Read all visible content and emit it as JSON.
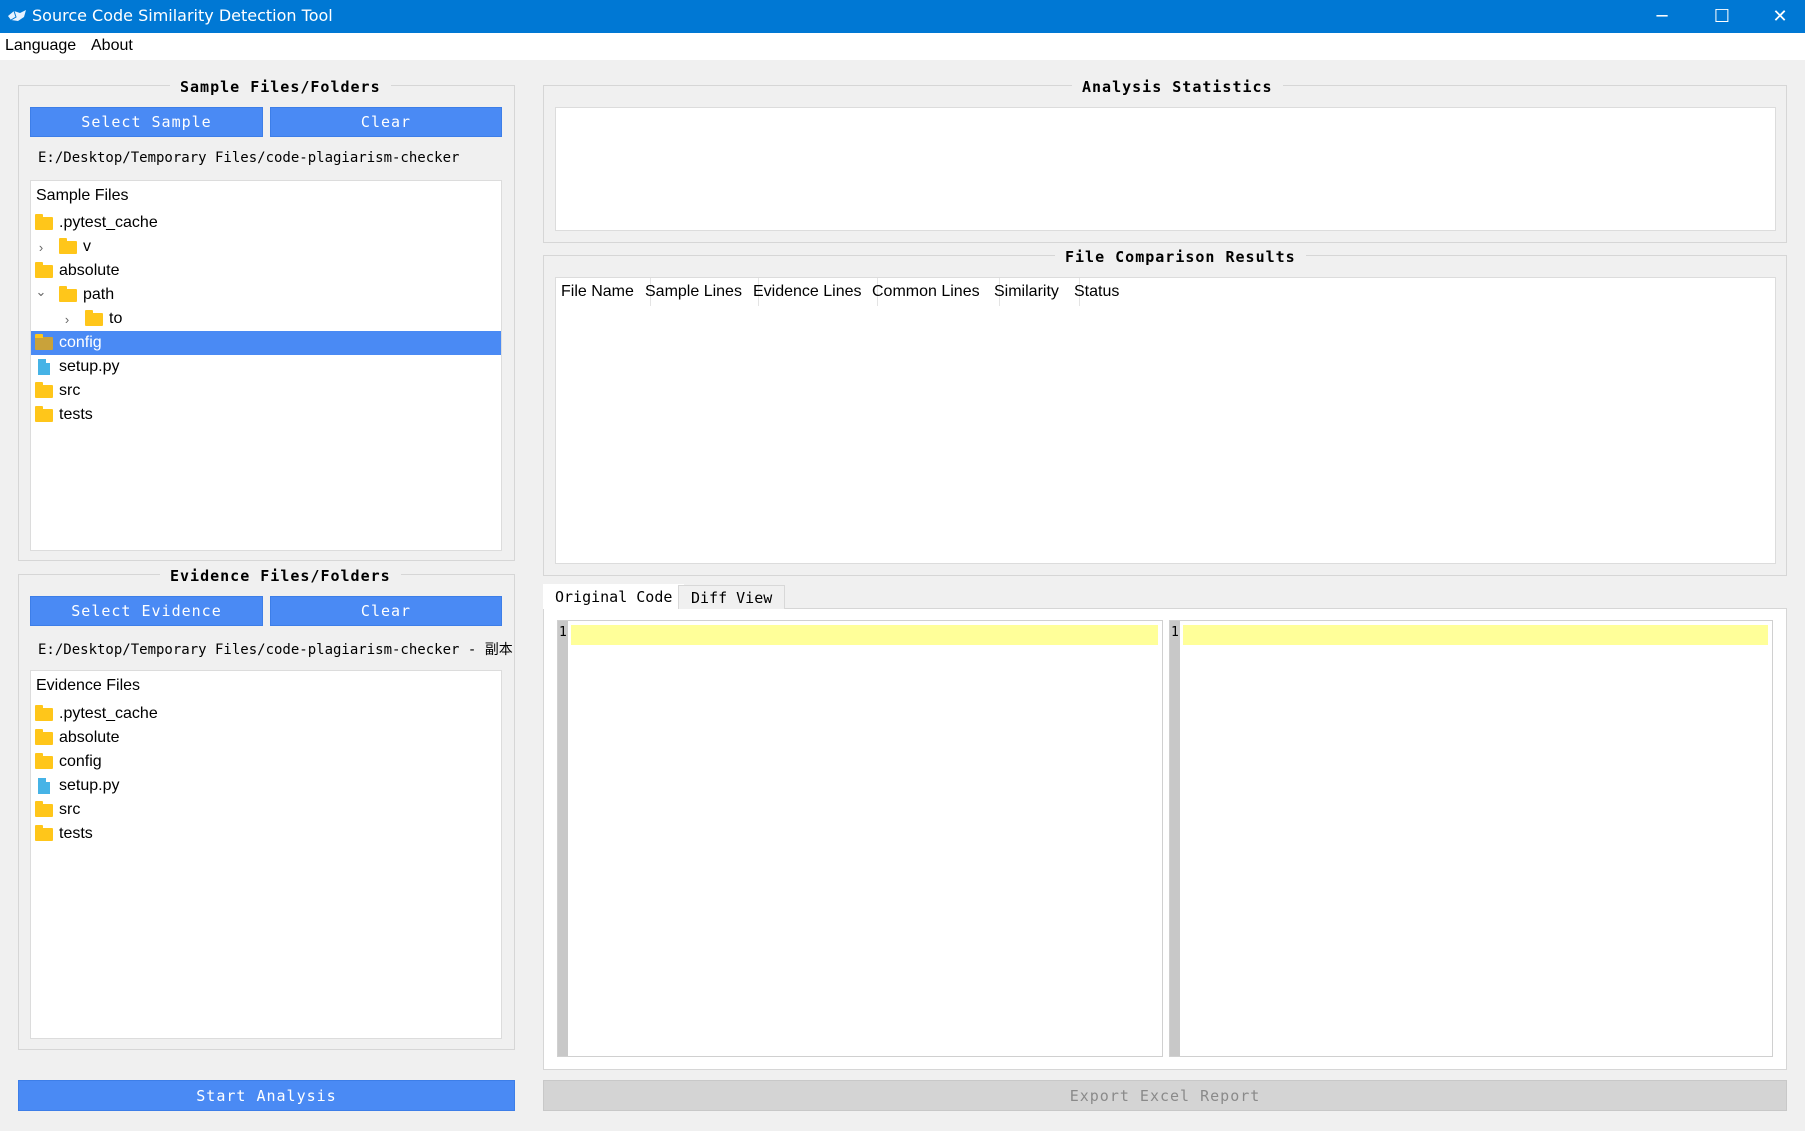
{
  "window": {
    "title": "Source Code Similarity Detection Tool",
    "controls": [
      "─",
      "☐",
      "✕"
    ]
  },
  "menu": {
    "items": [
      "Language",
      "About"
    ]
  },
  "sample": {
    "group_title": "Sample Files/Folders",
    "select_label": "Select Sample",
    "clear_label": "Clear",
    "path": "E:/Desktop/Temporary Files/code-plagiarism-checker",
    "tree_header": "Sample Files",
    "tree": [
      {
        "label": ".pytest_cache",
        "type": "folder",
        "depth": 0,
        "chevron": ""
      },
      {
        "label": "v",
        "type": "folder",
        "depth": 1,
        "chevron": "›"
      },
      {
        "label": "absolute",
        "type": "folder",
        "depth": 0,
        "chevron": ""
      },
      {
        "label": "path",
        "type": "folder",
        "depth": 1,
        "chevron": "⌄"
      },
      {
        "label": "to",
        "type": "folder",
        "depth": 2,
        "chevron": "›"
      },
      {
        "label": "config",
        "type": "folder",
        "depth": 0,
        "chevron": "",
        "selected": true
      },
      {
        "label": "setup.py",
        "type": "file",
        "depth": 0,
        "chevron": ""
      },
      {
        "label": "src",
        "type": "folder",
        "depth": 0,
        "chevron": ""
      },
      {
        "label": "tests",
        "type": "folder",
        "depth": 0,
        "chevron": ""
      }
    ]
  },
  "evidence": {
    "group_title": "Evidence Files/Folders",
    "select_label": "Select Evidence",
    "clear_label": "Clear",
    "path": "E:/Desktop/Temporary Files/code-plagiarism-checker - 副本",
    "tree_header": "Evidence Files",
    "tree": [
      {
        "label": ".pytest_cache",
        "type": "folder"
      },
      {
        "label": "absolute",
        "type": "folder"
      },
      {
        "label": "config",
        "type": "folder"
      },
      {
        "label": "setup.py",
        "type": "file"
      },
      {
        "label": "src",
        "type": "folder"
      },
      {
        "label": "tests",
        "type": "folder"
      }
    ]
  },
  "stats": {
    "group_title": "Analysis Statistics"
  },
  "results": {
    "group_title": "File Comparison Results",
    "columns": [
      "File Name",
      "Sample Lines",
      "Evidence Lines",
      "Common Lines",
      "Similarity",
      "Status"
    ]
  },
  "tabs": {
    "original": "Original Code",
    "diff": "Diff View"
  },
  "editors": {
    "left_line": "1",
    "right_line": "1"
  },
  "actions": {
    "start_label": "Start Analysis",
    "export_label": "Export Excel Report"
  },
  "colors": {
    "titlebar": "#0078d4",
    "accent": "#4a8af4",
    "highlight": "#ffff99",
    "folder": "#ffc61a"
  }
}
